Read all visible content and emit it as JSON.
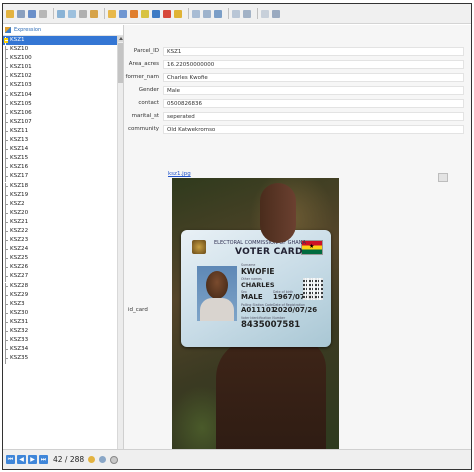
{
  "toolbar": {
    "icons": [
      "edit-icon",
      "save-icon",
      "refresh-icon",
      "delete-icon",
      "pan-icon",
      "zoom-icon",
      "back-icon",
      "select-icon",
      "filter-icon",
      "copy-icon",
      "paste-icon",
      "funnel-icon",
      "table-icon",
      "map-icon",
      "action-icon",
      "layout-icon",
      "columns-icon",
      "grid-icon",
      "print-icon",
      "help-icon"
    ]
  },
  "expression_label": "Expression",
  "features": [
    "KSZ1",
    "KSZ10",
    "KSZ100",
    "KSZ101",
    "KSZ102",
    "KSZ103",
    "KSZ104",
    "KSZ105",
    "KSZ106",
    "KSZ107",
    "KSZ11",
    "KSZ13",
    "KSZ14",
    "KSZ15",
    "KSZ16",
    "KSZ17",
    "KSZ18",
    "KSZ19",
    "KSZ2",
    "KSZ20",
    "KSZ21",
    "KSZ22",
    "KSZ23",
    "KSZ24",
    "KSZ25",
    "KSZ26",
    "KSZ27",
    "KSZ28",
    "KSZ29",
    "KSZ3",
    "KSZ30",
    "KSZ31",
    "KSZ32",
    "KSZ33",
    "KSZ34",
    "KSZ35"
  ],
  "form": {
    "fields": [
      {
        "label": "Parcel_ID",
        "value": "KSZ1"
      },
      {
        "label": "Area_acres",
        "value": "16.22050000000"
      },
      {
        "label": "former_nam",
        "value": "Charles Kwofie"
      },
      {
        "label": "Gender",
        "value": "Male"
      },
      {
        "label": "contact",
        "value": "0500826836"
      },
      {
        "label": "marital_st",
        "value": "seperated"
      },
      {
        "label": "community",
        "value": "Old Katwekromso"
      }
    ],
    "link_text": "ksz1.jpg",
    "id_card_label": "id_card"
  },
  "card": {
    "commission": "ELECTORAL COMMISSION OF GHANA",
    "title": "VOTER CARD",
    "surname_label": "Surname",
    "surname": "KWOFIE",
    "othernames_label": "Other names",
    "othernames": "CHARLES",
    "sex_label": "Sex",
    "sex": "MALE",
    "dob_label": "Date of birth",
    "dob": "1967/07/01",
    "polling_label": "Polling Station Code",
    "polling": "A011101",
    "reg_label": "Date of Registration",
    "reg_date": "2020/07/26",
    "voter_id_label": "Voter Identification Number",
    "voter_id": "8435007581"
  },
  "navigation": {
    "counter": "42 / 288"
  },
  "colors": {
    "selection": "#3476d4",
    "link": "#2255cc"
  }
}
